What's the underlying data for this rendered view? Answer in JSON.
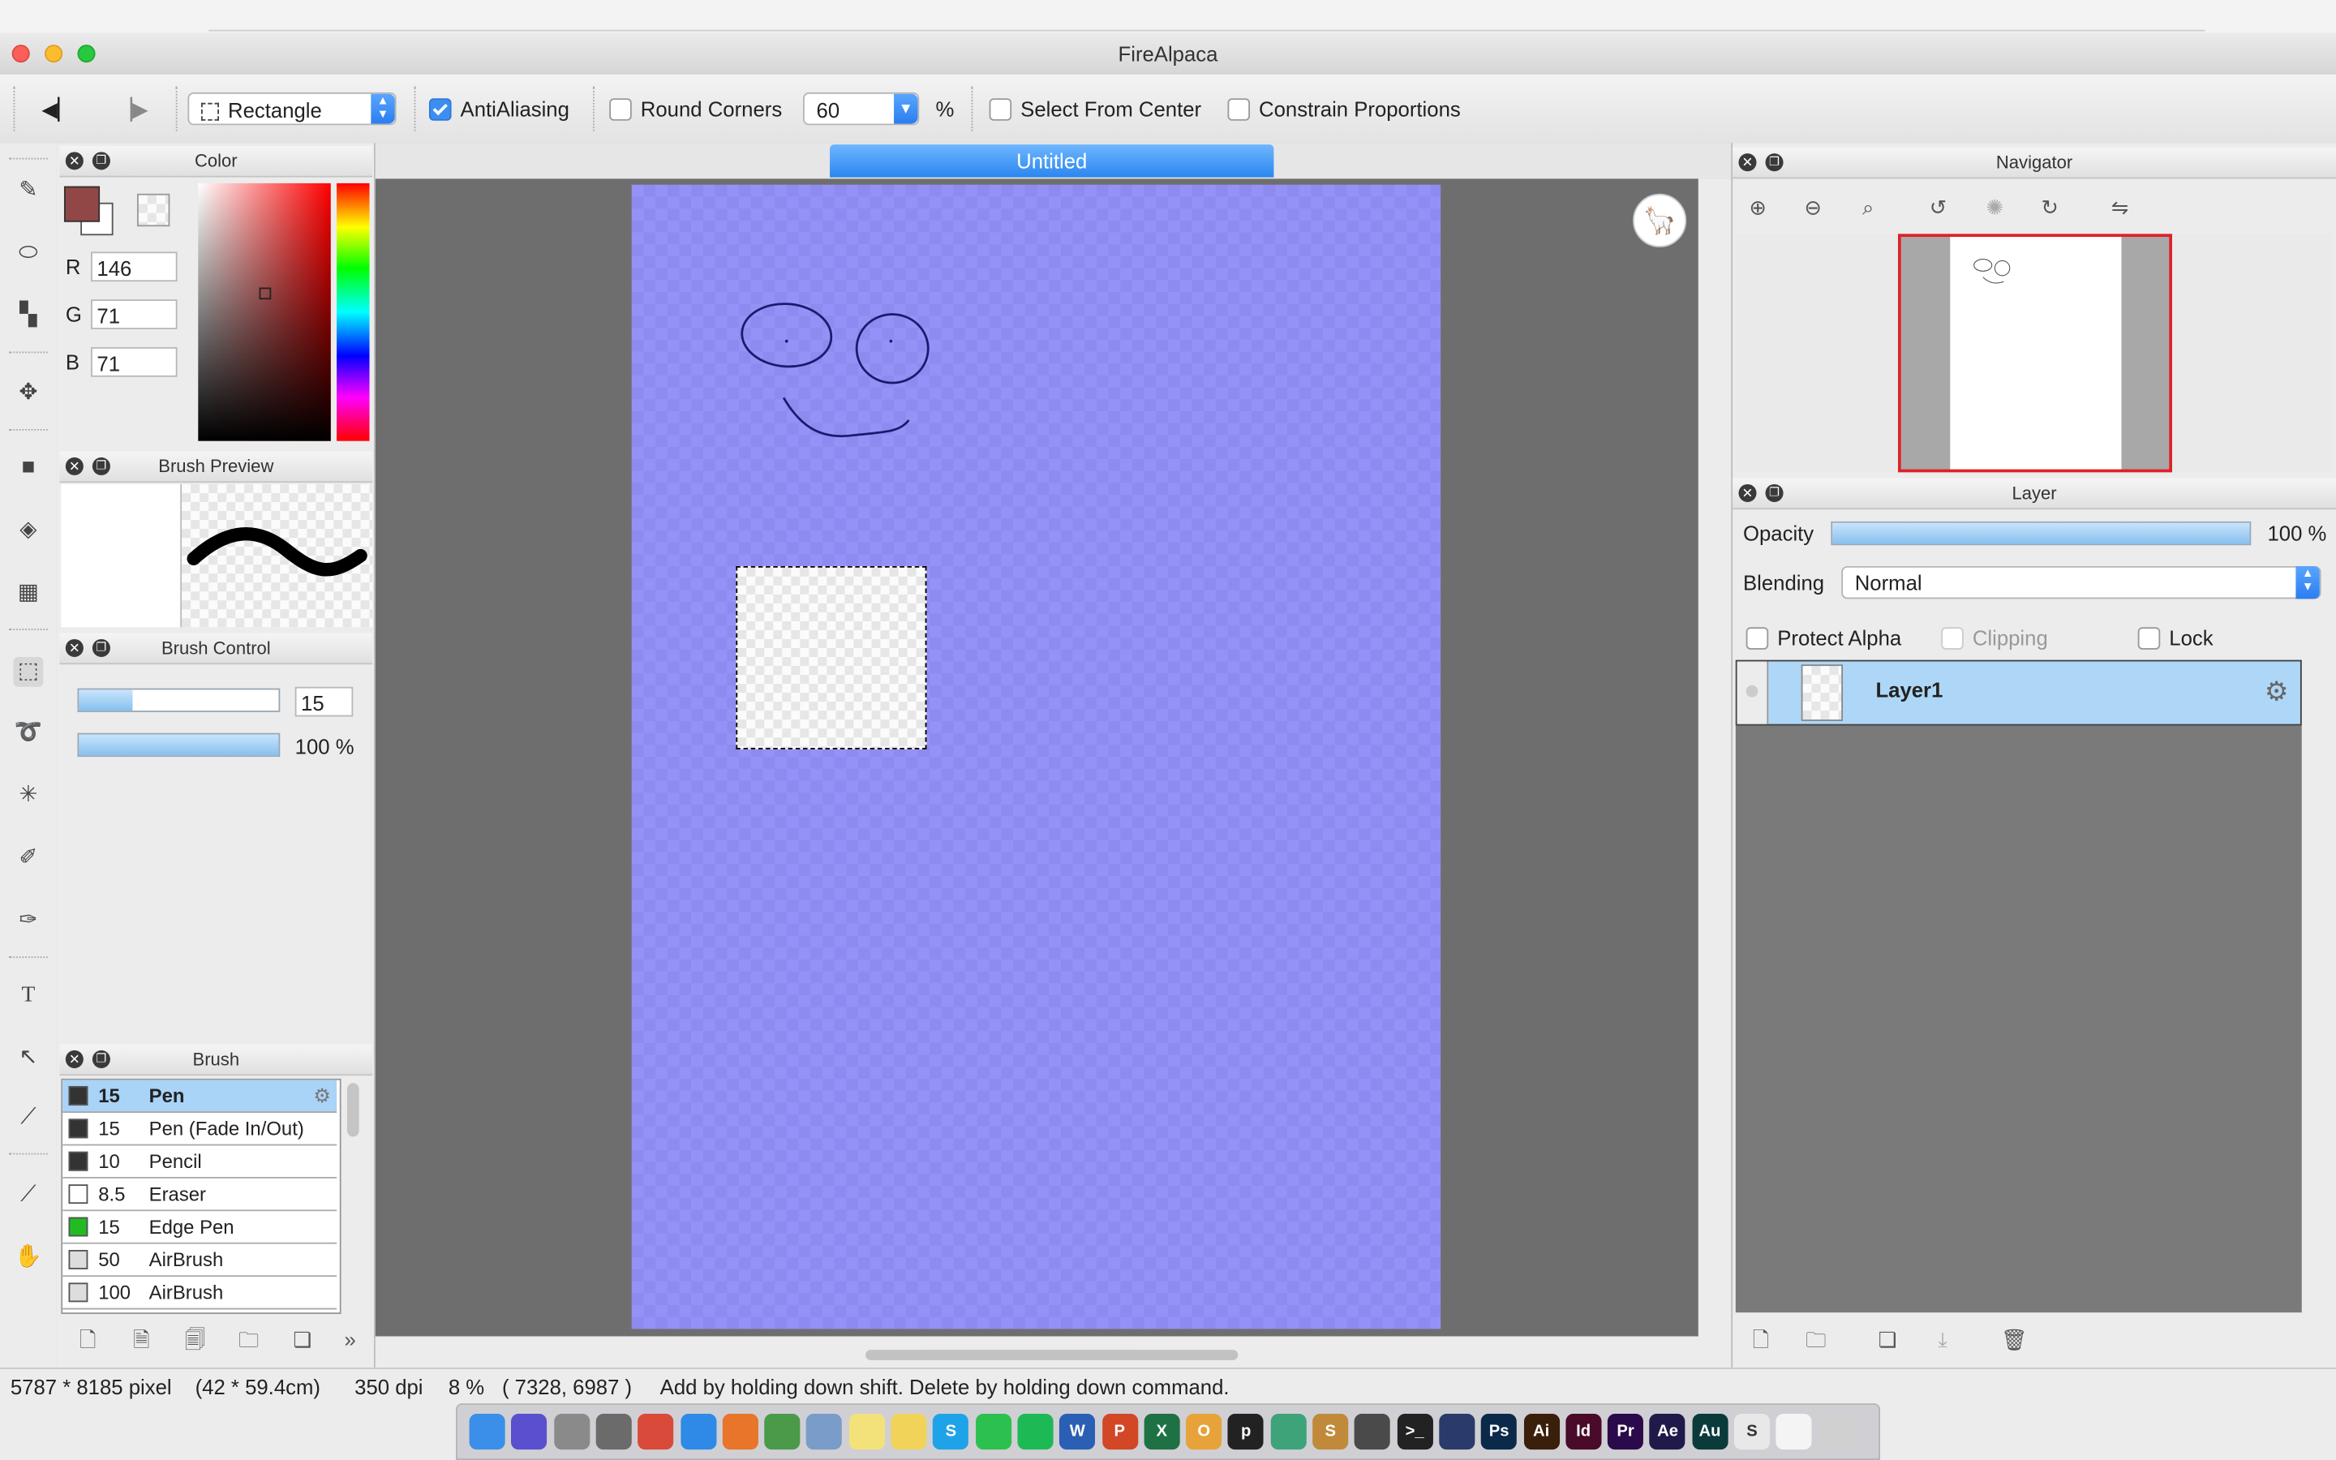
{
  "window": {
    "title": "FireAlpaca"
  },
  "toolbar": {
    "shape_select": "Rectangle",
    "antialiasing_label": "AntiAliasing",
    "antialiasing_checked": true,
    "round_corners_label": "Round Corners",
    "round_corners_checked": false,
    "corner_value": "60",
    "percent_sign": "%",
    "select_from_center_label": "Select From Center",
    "constrain_proportions_label": "Constrain Proportions"
  },
  "color_panel": {
    "title": "Color",
    "r_label": "R",
    "r_value": "146",
    "g_label": "G",
    "g_value": "71",
    "b_label": "B",
    "b_value": "71",
    "foreground_color": "#924747"
  },
  "brush_preview_panel": {
    "title": "Brush Preview"
  },
  "brush_control_panel": {
    "title": "Brush Control",
    "size_value": "15",
    "size_fraction": 0.27,
    "opacity_label": "100 %",
    "opacity_fraction": 1.0
  },
  "brush_panel": {
    "title": "Brush",
    "items": [
      {
        "size": "15",
        "name": "Pen",
        "color": "#333333",
        "selected": true
      },
      {
        "size": "15",
        "name": "Pen (Fade In/Out)",
        "color": "#333333"
      },
      {
        "size": "10",
        "name": "Pencil",
        "color": "#333333"
      },
      {
        "size": "8.5",
        "name": "Eraser",
        "color": "#ffffff"
      },
      {
        "size": "15",
        "name": "Edge Pen",
        "color": "#22bb22"
      },
      {
        "size": "50",
        "name": "AirBrush",
        "color": "#dddddd"
      },
      {
        "size": "100",
        "name": "AirBrush",
        "color": "#dddddd"
      }
    ]
  },
  "document": {
    "tab_title": "Untitled",
    "page_color": "#9592f7"
  },
  "navigator_panel": {
    "title": "Navigator"
  },
  "layer_panel": {
    "title": "Layer",
    "opacity_label": "Opacity",
    "opacity_value": "100 %",
    "opacity_fraction": 1.0,
    "blending_label": "Blending",
    "blending_value": "Normal",
    "protect_alpha_label": "Protect Alpha",
    "clipping_label": "Clipping",
    "lock_label": "Lock",
    "layers": [
      {
        "name": "Layer1"
      }
    ]
  },
  "status_bar": {
    "size": "5787 * 8185 pixel",
    "physical": "(42 * 59.4cm)",
    "dpi": "350 dpi",
    "zoom": "8 %",
    "coords": "( 7328, 6987 )",
    "hint": "Add by holding down shift. Delete by holding down command."
  },
  "dock": {
    "apps": [
      {
        "name": "finder-icon",
        "label": "",
        "color": "#3b8fe8"
      },
      {
        "name": "siri-icon",
        "label": "",
        "color": "#5a4fcf"
      },
      {
        "name": "launchpad-icon",
        "label": "",
        "color": "#8a8a8a"
      },
      {
        "name": "system-preferences-icon",
        "label": "",
        "color": "#6b6b6b"
      },
      {
        "name": "chrome-icon",
        "label": "",
        "color": "#d94a3a"
      },
      {
        "name": "safari-icon",
        "label": "",
        "color": "#2e8ae6"
      },
      {
        "name": "firefox-icon",
        "label": "",
        "color": "#e8752a"
      },
      {
        "name": "network-icon",
        "label": "",
        "color": "#4a9a4a"
      },
      {
        "name": "preview-icon",
        "label": "",
        "color": "#7a9cc8"
      },
      {
        "name": "notes-icon",
        "label": "",
        "color": "#f3e27a"
      },
      {
        "name": "stickies-icon",
        "label": "",
        "color": "#f1d35a"
      },
      {
        "name": "skype-icon",
        "label": "S",
        "color": "#1fa3e8"
      },
      {
        "name": "whatsapp-icon",
        "label": "",
        "color": "#2cc04f"
      },
      {
        "name": "spotify-icon",
        "label": "",
        "color": "#1db954"
      },
      {
        "name": "word-icon",
        "label": "W",
        "color": "#2b5fb3"
      },
      {
        "name": "powerpoint-icon",
        "label": "P",
        "color": "#d24726"
      },
      {
        "name": "excel-icon",
        "label": "X",
        "color": "#1e7145"
      },
      {
        "name": "opera-icon",
        "label": "O",
        "color": "#e8a23a"
      },
      {
        "name": "pinterest-icon",
        "label": "p",
        "color": "#222222"
      },
      {
        "name": "atom-icon",
        "label": "",
        "color": "#3fa37a"
      },
      {
        "name": "sublime-icon",
        "label": "S",
        "color": "#c08a3a"
      },
      {
        "name": "books-icon",
        "label": "",
        "color": "#4a4a4a"
      },
      {
        "name": "terminal-icon",
        "label": ">_",
        "color": "#222222"
      },
      {
        "name": "cinema4d-icon",
        "label": "",
        "color": "#2a3a6a"
      },
      {
        "name": "photoshop-icon",
        "label": "Ps",
        "color": "#0b2a4a"
      },
      {
        "name": "illustrator-icon",
        "label": "Ai",
        "color": "#3a1f0a"
      },
      {
        "name": "indesign-icon",
        "label": "Id",
        "color": "#4a0a2a"
      },
      {
        "name": "premiere-icon",
        "label": "Pr",
        "color": "#2a0a4a"
      },
      {
        "name": "after-effects-icon",
        "label": "Ae",
        "color": "#1f1a4a"
      },
      {
        "name": "audition-icon",
        "label": "Au",
        "color": "#0a3a3a"
      },
      {
        "name": "document-icon",
        "label": "S",
        "color": "#e8e8e8"
      },
      {
        "name": "firealpaca-icon",
        "label": "",
        "color": "#f4f4f4"
      },
      {
        "name": "trash-icon",
        "label": "",
        "color": "#d0d0d0"
      }
    ]
  }
}
